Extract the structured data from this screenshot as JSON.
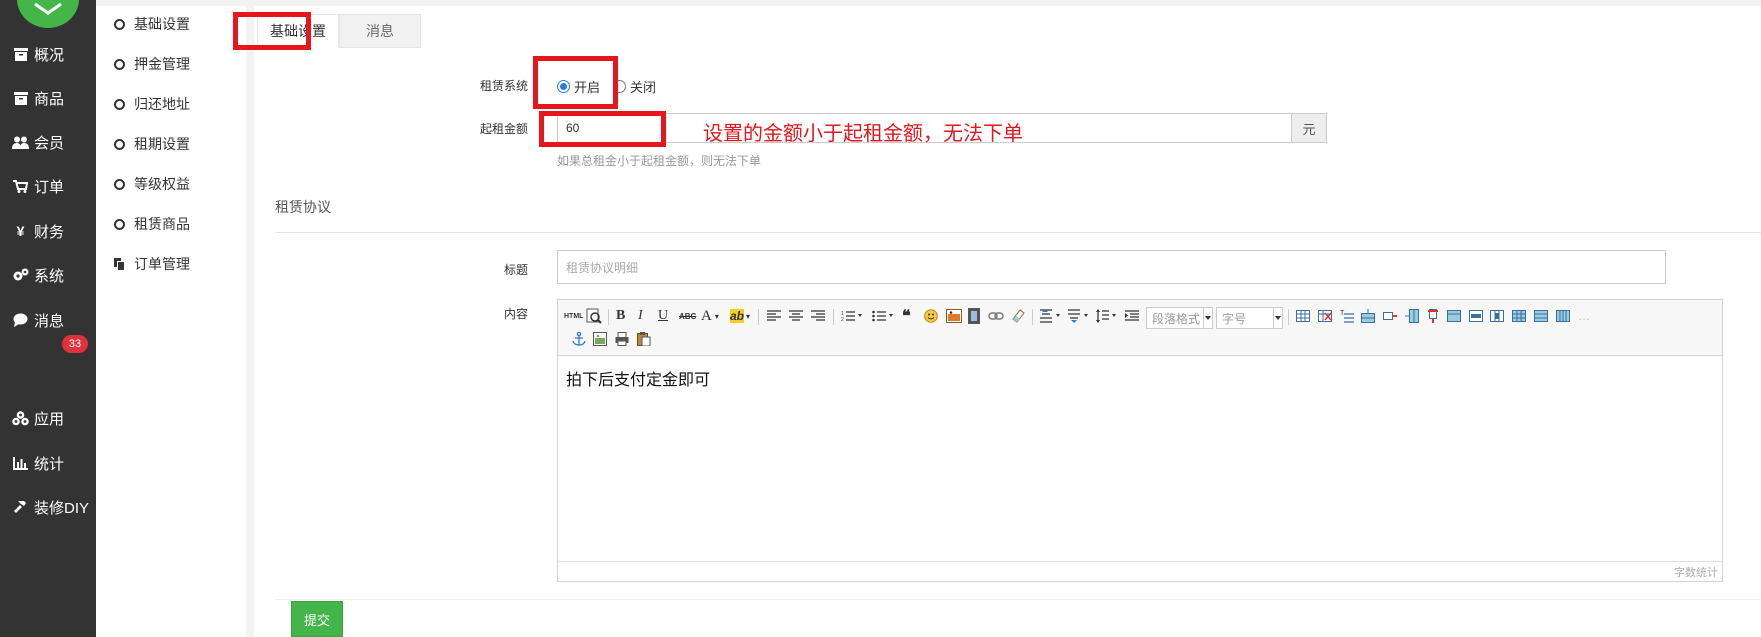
{
  "nav": {
    "items": [
      {
        "label": "概况",
        "icon": "dashboard-icon"
      },
      {
        "label": "商品",
        "icon": "goods-icon"
      },
      {
        "label": "会员",
        "icon": "users-icon"
      },
      {
        "label": "订单",
        "icon": "cart-icon"
      },
      {
        "label": "财务",
        "icon": "yen-icon"
      },
      {
        "label": "系统",
        "icon": "cogs-icon"
      },
      {
        "label": "消息",
        "icon": "chat-icon"
      },
      {
        "label": "应用",
        "icon": "cubes-icon"
      },
      {
        "label": "统计",
        "icon": "bar-chart-icon"
      },
      {
        "label": "装修DIY",
        "icon": "hammer-icon"
      }
    ],
    "message_badge": "33",
    "brand_color": "#44b549"
  },
  "submenu": {
    "items": [
      {
        "label": "基础设置"
      },
      {
        "label": "押金管理"
      },
      {
        "label": "归还地址"
      },
      {
        "label": "租期设置"
      },
      {
        "label": "等级权益"
      },
      {
        "label": "租赁商品"
      },
      {
        "label": "订单管理"
      }
    ]
  },
  "tabs": [
    {
      "label": "基础设置",
      "active": true
    },
    {
      "label": "消息",
      "active": false
    }
  ],
  "form": {
    "lease_system_label": "租赁系统",
    "lease_on_label": "开启",
    "lease_off_label": "关闭",
    "lease_selected": "开启",
    "min_amount_label": "起租金额",
    "min_amount_value": "60",
    "min_amount_unit": "元",
    "min_amount_help": "如果总租金小于起租金额，则无法下单",
    "annotation": "设置的金额小于起租金额，无法下单"
  },
  "agreement": {
    "section_title": "租赁协议",
    "title_label": "标题",
    "title_placeholder": "租赁协议明细",
    "content_label": "内容",
    "content_text": "拍下后支付定金即可",
    "paragraph_format": "段落格式",
    "font_size": "字号",
    "word_count": "字数统计"
  },
  "submit_label": "提交",
  "highlight_color": "#e6161d"
}
